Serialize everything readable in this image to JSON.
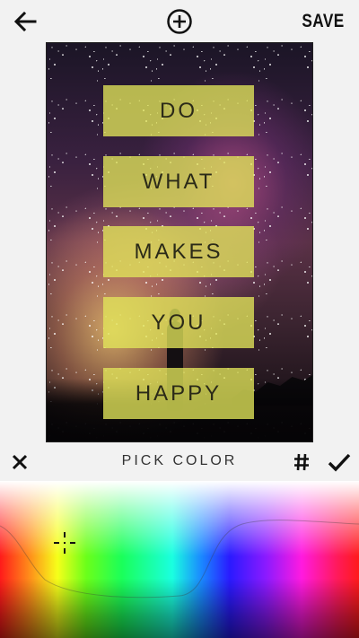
{
  "toolbar": {
    "back_icon": "arrow-left-icon",
    "add_icon": "plus-circle-icon",
    "save_label": "SAVE"
  },
  "poster": {
    "words": [
      "DO",
      "WHAT",
      "MAKES",
      "YOU",
      "HAPPY"
    ],
    "box_color": "#e2e65a"
  },
  "picker_bar": {
    "close_icon": "close-icon",
    "title": "PICK COLOR",
    "hex_label": "#",
    "confirm_icon": "check-icon"
  },
  "color_picker": {
    "selector_icon": "crosshair-icon"
  }
}
